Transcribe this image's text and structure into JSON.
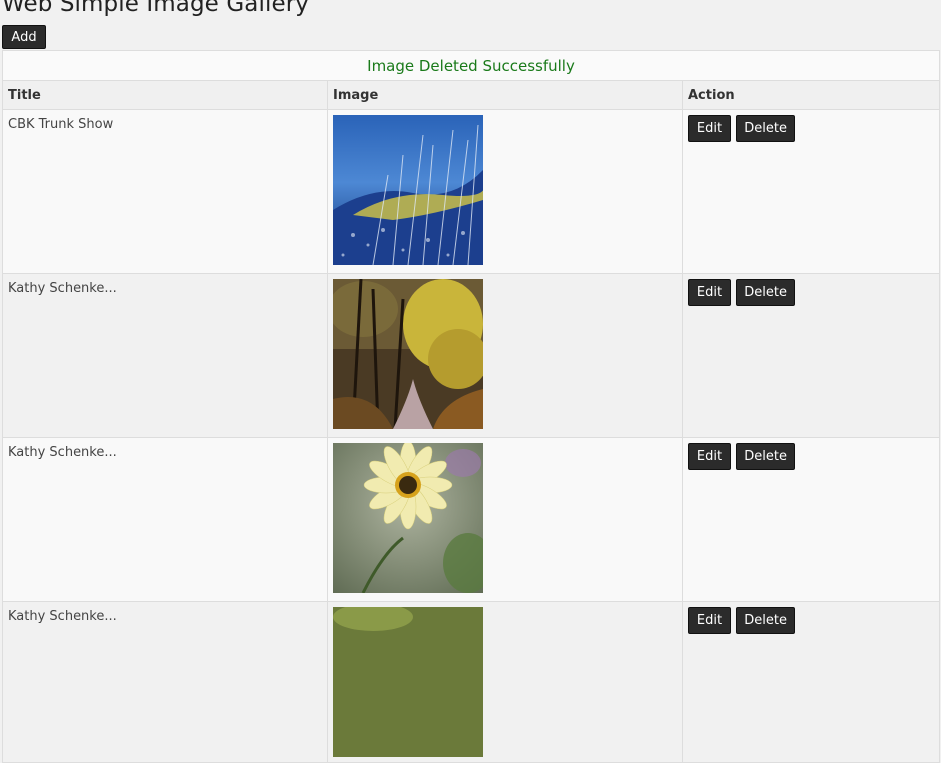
{
  "page": {
    "title": "Web Simple Image Gallery",
    "add_label": "Add"
  },
  "message": "Image Deleted Successfully",
  "columns": {
    "title": "Title",
    "image": "Image",
    "action": "Action"
  },
  "rows": [
    {
      "title": "CBK Trunk Show",
      "image": "blue-grass-image",
      "edit": "Edit",
      "delete": "Delete"
    },
    {
      "title": "Kathy Schenke...",
      "image": "autumn-path-image",
      "edit": "Edit",
      "delete": "Delete"
    },
    {
      "title": "Kathy Schenke...",
      "image": "yellow-flower-image",
      "edit": "Edit",
      "delete": "Delete"
    },
    {
      "title": "Kathy Schenke...",
      "image": "green-image",
      "edit": "Edit",
      "delete": "Delete"
    }
  ],
  "colors": {
    "success_text": "#1a7a1a",
    "button_bg": "#2b2b2b"
  }
}
